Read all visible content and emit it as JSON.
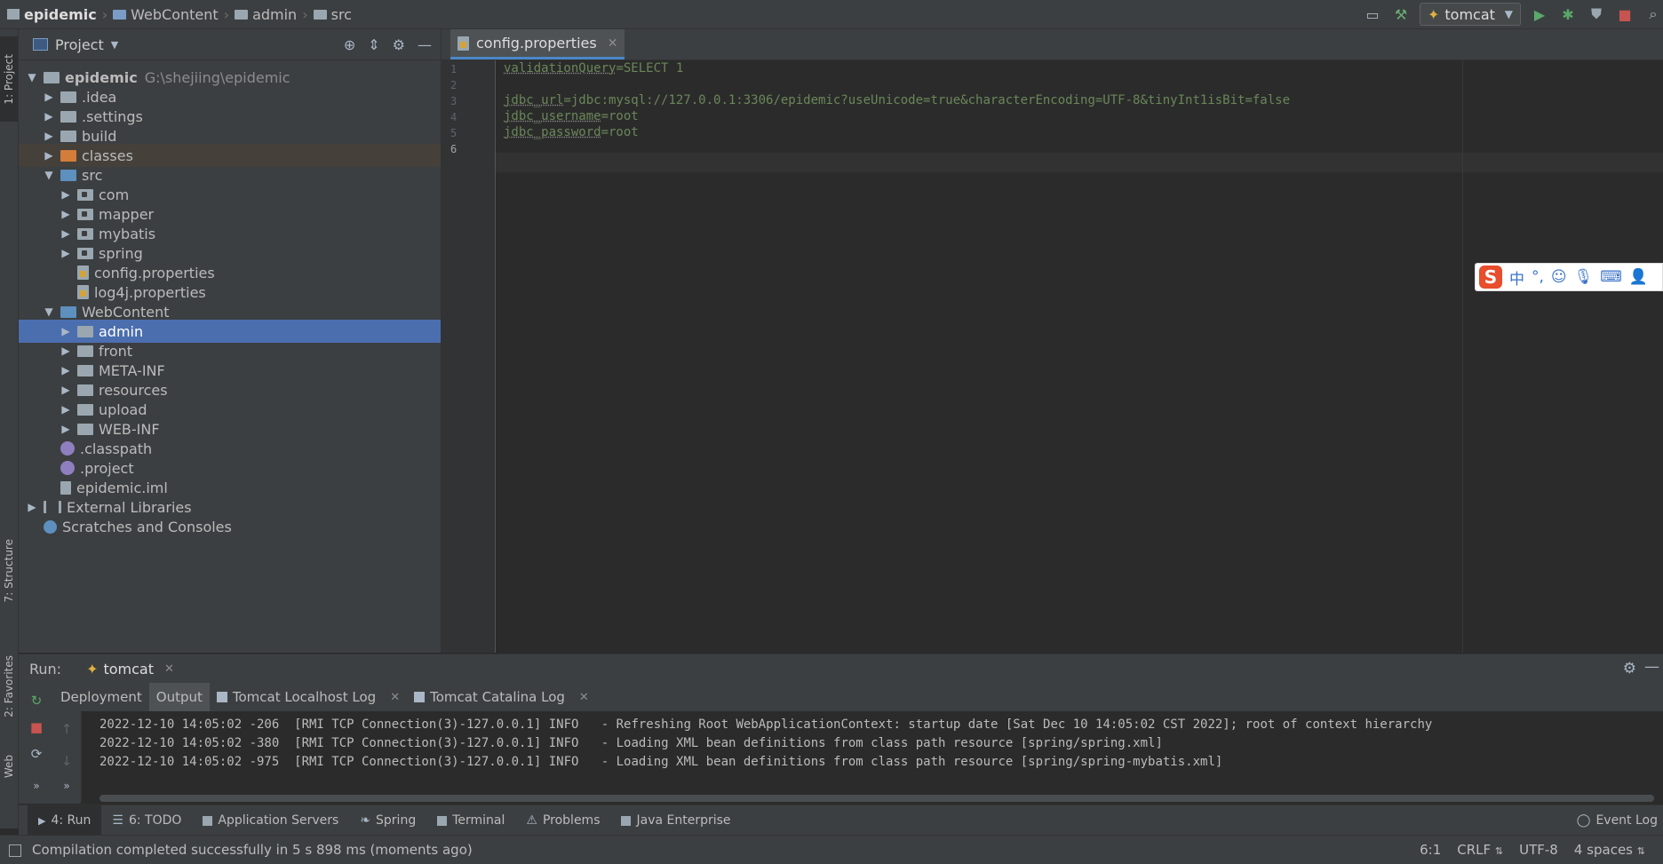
{
  "breadcrumb": [
    "epidemic",
    "WebContent",
    "admin",
    "src"
  ],
  "toolbar": {
    "run_config": "tomcat"
  },
  "left_stripe": {
    "project": "1: Project",
    "structure": "7: Structure",
    "favorites": "2: Favorites",
    "web": "Web"
  },
  "project_panel": {
    "title": "Project",
    "tree": [
      {
        "label": "epidemic",
        "path": "G:\\shejiing\\epidemic",
        "depth": 0,
        "expanded": true,
        "icon": "project-folder-icon"
      },
      {
        "label": ".idea",
        "depth": 1,
        "expanded": false,
        "icon": "folder-icon"
      },
      {
        "label": ".settings",
        "depth": 1,
        "expanded": false,
        "icon": "folder-icon"
      },
      {
        "label": "build",
        "depth": 1,
        "expanded": false,
        "icon": "folder-icon"
      },
      {
        "label": "classes",
        "depth": 1,
        "expanded": false,
        "icon": "excluded-folder-icon"
      },
      {
        "label": "src",
        "depth": 1,
        "expanded": true,
        "icon": "source-folder-icon"
      },
      {
        "label": "com",
        "depth": 2,
        "expanded": false,
        "icon": "package-icon"
      },
      {
        "label": "mapper",
        "depth": 2,
        "expanded": false,
        "icon": "package-icon"
      },
      {
        "label": "mybatis",
        "depth": 2,
        "expanded": false,
        "icon": "package-icon"
      },
      {
        "label": "spring",
        "depth": 2,
        "expanded": false,
        "icon": "package-icon"
      },
      {
        "label": "config.properties",
        "depth": 2,
        "icon": "properties-file-icon"
      },
      {
        "label": "log4j.properties",
        "depth": 2,
        "icon": "properties-file-icon"
      },
      {
        "label": "WebContent",
        "depth": 1,
        "expanded": true,
        "icon": "web-folder-icon"
      },
      {
        "label": "admin",
        "depth": 2,
        "expanded": false,
        "icon": "folder-icon",
        "selected": true
      },
      {
        "label": "front",
        "depth": 2,
        "expanded": false,
        "icon": "folder-icon"
      },
      {
        "label": "META-INF",
        "depth": 2,
        "expanded": false,
        "icon": "folder-icon"
      },
      {
        "label": "resources",
        "depth": 2,
        "expanded": false,
        "icon": "folder-icon"
      },
      {
        "label": "upload",
        "depth": 2,
        "expanded": false,
        "icon": "folder-icon"
      },
      {
        "label": "WEB-INF",
        "depth": 2,
        "expanded": false,
        "icon": "folder-icon"
      },
      {
        "label": ".classpath",
        "depth": 1,
        "icon": "eclipse-file-icon"
      },
      {
        "label": ".project",
        "depth": 1,
        "icon": "eclipse-file-icon"
      },
      {
        "label": "epidemic.iml",
        "depth": 1,
        "icon": "iml-file-icon"
      },
      {
        "label": "External Libraries",
        "depth": 0,
        "expanded": false,
        "icon": "libraries-icon"
      },
      {
        "label": "Scratches and Consoles",
        "depth": 0,
        "icon": "scratches-icon"
      }
    ]
  },
  "editor": {
    "tab": "config.properties",
    "lines": [
      {
        "n": "1",
        "key": "validationQuery",
        "value": "=SELECT 1"
      },
      {
        "n": "2",
        "key": "",
        "value": ""
      },
      {
        "n": "3",
        "key": "jdbc_url",
        "value": "=jdbc:mysql://127.0.0.1:3306/epidemic?useUnicode=true&characterEncoding=UTF-8&tinyInt1isBit=false"
      },
      {
        "n": "4",
        "key": "jdbc_username",
        "value": "=root"
      },
      {
        "n": "5",
        "key": "jdbc_password",
        "value": "=root"
      },
      {
        "n": "6",
        "key": "",
        "value": ""
      }
    ]
  },
  "ime": {
    "mode": "中",
    "punct": "°,"
  },
  "run": {
    "label": "Run:",
    "tab": "tomcat",
    "subtabs": [
      "Deployment",
      "Output",
      "Tomcat Localhost Log",
      "Tomcat Catalina Log"
    ],
    "log": [
      "2022-12-10 14:05:02 -206  [RMI TCP Connection(3)-127.0.0.1] INFO   - Refreshing Root WebApplicationContext: startup date [Sat Dec 10 14:05:02 CST 2022]; root of context hierarchy",
      "2022-12-10 14:05:02 -380  [RMI TCP Connection(3)-127.0.0.1] INFO   - Loading XML bean definitions from class path resource [spring/spring.xml]",
      "2022-12-10 14:05:02 -975  [RMI TCP Connection(3)-127.0.0.1] INFO   - Loading XML bean definitions from class path resource [spring/spring-mybatis.xml]"
    ]
  },
  "bottom_tabs": [
    "4: Run",
    "6: TODO",
    "Application Servers",
    "Spring",
    "Terminal",
    "Problems",
    "Java Enterprise"
  ],
  "event_log": "Event Log",
  "status": {
    "message": "Compilation completed successfully in 5 s 898 ms (moments ago)",
    "position": "6:1",
    "line_sep": "CRLF",
    "encoding": "UTF-8",
    "indent": "4 spaces"
  }
}
